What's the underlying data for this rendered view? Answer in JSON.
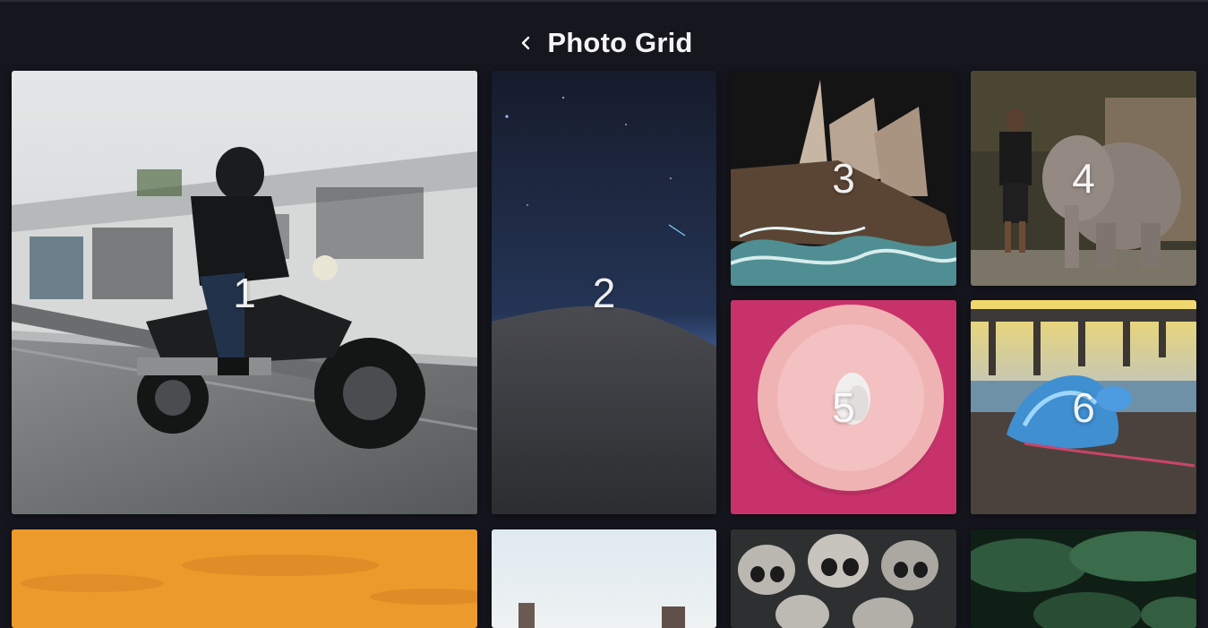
{
  "header": {
    "title": "Photo Grid",
    "back_icon": "chevron-left-icon"
  },
  "colors": {
    "background": "#16161f",
    "title": "#f4f4f6"
  },
  "tiles": [
    {
      "label": "1",
      "subject": "motorcycle rider on road"
    },
    {
      "label": "2",
      "subject": "night sky over sand dune"
    },
    {
      "label": "3",
      "subject": "sailing ship drawing"
    },
    {
      "label": "4",
      "subject": "man with elephant"
    },
    {
      "label": "5",
      "subject": "egg on pink plate"
    },
    {
      "label": "6",
      "subject": "jellyfish on beach"
    },
    {
      "label": "",
      "subject": "orange sky"
    },
    {
      "label": "",
      "subject": "desert rocks"
    },
    {
      "label": "",
      "subject": "skulls"
    },
    {
      "label": "",
      "subject": "green leaves"
    }
  ]
}
